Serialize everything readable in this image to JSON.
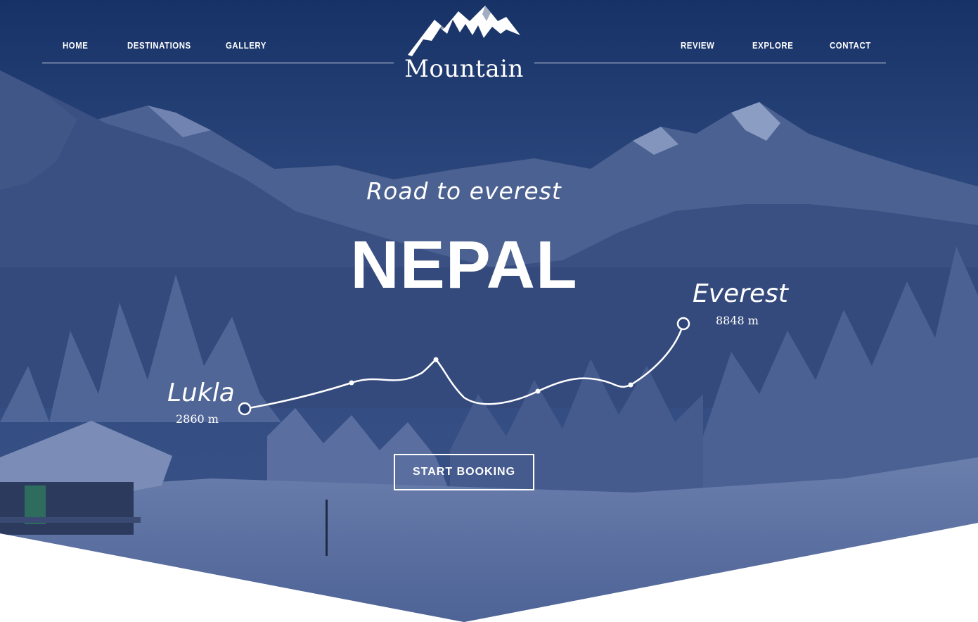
{
  "nav": {
    "left": [
      {
        "label": "HOME"
      },
      {
        "label": "DESTINATIONS"
      },
      {
        "label": "GALLERY"
      }
    ],
    "right": [
      {
        "label": "REVIEW"
      },
      {
        "label": "EXPLORE"
      },
      {
        "label": "CONTACT"
      }
    ]
  },
  "logo": {
    "text": "Mountain",
    "icon": "mountain-peaks-icon"
  },
  "hero": {
    "subtitle": "Road to everest",
    "headline": "NEPAL",
    "start": {
      "name": "Lukla",
      "altitude": "2860 m"
    },
    "end": {
      "name": "Everest",
      "altitude": "8848 m"
    },
    "cta_label": "START BOOKING"
  },
  "colors": {
    "overlay": "#1c3566",
    "text": "#ffffff"
  }
}
